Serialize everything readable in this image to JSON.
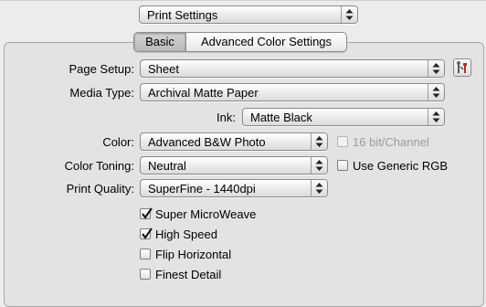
{
  "header": {
    "settings_menu": "Print Settings"
  },
  "tabs": [
    {
      "label": "Basic",
      "selected": true
    },
    {
      "label": "Advanced Color Settings",
      "selected": false
    }
  ],
  "form": {
    "page_setup": {
      "label": "Page Setup:",
      "value": "Sheet"
    },
    "media_type": {
      "label": "Media Type:",
      "value": "Archival Matte Paper"
    },
    "ink": {
      "label": "Ink:",
      "value": "Matte Black"
    },
    "color": {
      "label": "Color:",
      "value": "Advanced B&W Photo"
    },
    "color_toning": {
      "label": "Color Toning:",
      "value": "Neutral"
    },
    "print_quality": {
      "label": "Print Quality:",
      "value": "SuperFine - 1440dpi"
    }
  },
  "options": {
    "bit16": {
      "label": "16 bit/Channel",
      "checked": false,
      "enabled": false
    },
    "use_generic_rgb": {
      "label": "Use Generic RGB",
      "checked": false,
      "enabled": true
    },
    "super_microweave": {
      "label": "Super MicroWeave",
      "checked": true
    },
    "high_speed": {
      "label": "High Speed",
      "checked": true
    },
    "flip_horizontal": {
      "label": "Flip Horizontal",
      "checked": false
    },
    "finest_detail": {
      "label": "Finest Detail",
      "checked": false
    }
  },
  "icons": {
    "arrows": "up-down-arrows-icon",
    "checkmark": "checkmark-icon",
    "utility": "tools-icon"
  },
  "colors": {
    "window_bg": "#ececec",
    "panel_bg": "#e3e3e3",
    "disabled_text": "#9c9c9c",
    "utility_red": "#c8242a"
  }
}
